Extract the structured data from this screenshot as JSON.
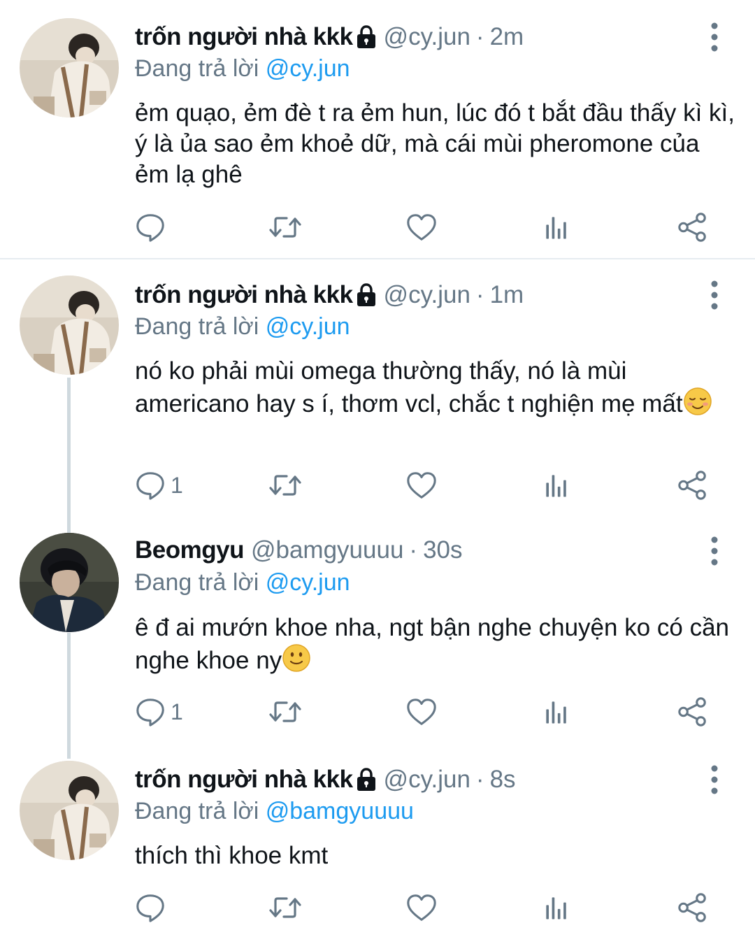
{
  "tweets": [
    {
      "name": "trốn người nhà kkk",
      "locked": true,
      "handle": "@cy.jun",
      "dot": "·",
      "time": "2m",
      "reply_prefix": "Đang trả lời",
      "reply_to": "@cy.jun",
      "text": "ẻm quạo, ẻm đè t ra ẻm hun, lúc đó t bắt đầu thấy kì kì, ý là ủa sao ẻm khoẻ dữ, mà cái mùi pheromone của ẻm lạ ghê",
      "emoji": "",
      "reply_count": ""
    },
    {
      "name": "trốn người nhà kkk",
      "locked": true,
      "handle": "@cy.jun",
      "dot": "·",
      "time": "1m",
      "reply_prefix": "Đang trả lời",
      "reply_to": "@cy.jun",
      "text": "nó ko phải mùi omega thường thấy, nó là mùi americano hay s í, thơm vcl, chắc t nghiện mẹ mất",
      "emoji": "relieved-face",
      "reply_count": "1"
    },
    {
      "name": "Beomgyu",
      "locked": false,
      "handle": "@bamgyuuuu",
      "dot": "·",
      "time": "30s",
      "reply_prefix": "Đang trả lời",
      "reply_to": "@cy.jun",
      "text": "ê đ ai mướn khoe nha, ngt bận nghe chuyện ko có cần nghe khoe ny",
      "emoji": "slightly-smiling-face",
      "reply_count": "1"
    },
    {
      "name": "trốn người nhà kkk",
      "locked": true,
      "handle": "@cy.jun",
      "dot": "·",
      "time": "8s",
      "reply_prefix": "Đang trả lời",
      "reply_to": "@bamgyuuuu",
      "text": "thích thì khoe kmt",
      "emoji": "",
      "reply_count": ""
    }
  ],
  "icons": {
    "reply": "reply-icon",
    "retweet": "retweet-icon",
    "like": "heart-icon",
    "analytics": "analytics-icon",
    "share": "share-icon",
    "more": "more-vertical-icon",
    "lock": "lock-icon"
  },
  "colors": {
    "text": "#0f1419",
    "secondary": "#657786",
    "mention": "#1d9bf0",
    "thread_line": "#cfd9de"
  }
}
